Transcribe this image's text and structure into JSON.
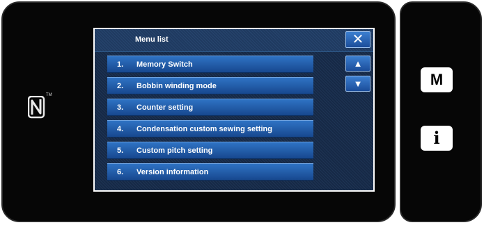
{
  "device": {
    "nfc_icon": "nfc-n-mark-icon",
    "nfc_trademark": "TM"
  },
  "dialog": {
    "title": "Menu list",
    "close_glyph": "✕",
    "scroll_up_glyph": "▲",
    "scroll_down_glyph": "▼",
    "items": [
      {
        "number": "1.",
        "label": "Memory Switch"
      },
      {
        "number": "2.",
        "label": "Bobbin winding mode"
      },
      {
        "number": "3.",
        "label": "Counter setting"
      },
      {
        "number": "4.",
        "label": "Condensation custom sewing setting"
      },
      {
        "number": "5.",
        "label": "Custom pitch setting"
      },
      {
        "number": "6.",
        "label": "Version information"
      }
    ]
  },
  "side_panel": {
    "m_label": "M",
    "info_label": "i"
  },
  "colors": {
    "bezel": "#060606",
    "button_blue": "#2f73c4",
    "screen_bg": "#162946"
  }
}
